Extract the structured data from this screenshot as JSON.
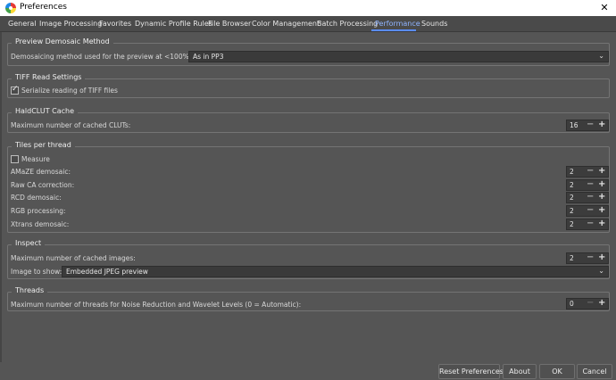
{
  "window": {
    "title": "Preferences"
  },
  "tabs": [
    {
      "label": "General"
    },
    {
      "label": "Image Processing"
    },
    {
      "label": "Favorites"
    },
    {
      "label": "Dynamic Profile Rules"
    },
    {
      "label": "File Browser"
    },
    {
      "label": "Color Management"
    },
    {
      "label": "Batch Processing"
    },
    {
      "label": "Performance"
    },
    {
      "label": "Sounds"
    }
  ],
  "active_tab": "Performance",
  "preview_demosaic": {
    "title": "Preview Demosaic Method",
    "label": "Demosaicing method used for the preview at <100% zoom:",
    "value": "As in PP3"
  },
  "tiff": {
    "title": "TIFF Read Settings",
    "checkbox_label": "Serialize reading of TIFF files",
    "checked": true
  },
  "haldclut": {
    "title": "HaldCLUT Cache",
    "label": "Maximum number of cached CLUTs:",
    "value": "16"
  },
  "tiles": {
    "title": "Tiles per thread",
    "measure_label": "Measure",
    "measure_checked": false,
    "rows": [
      {
        "label": "AMaZE demosaic:",
        "value": "2"
      },
      {
        "label": "Raw CA correction:",
        "value": "2"
      },
      {
        "label": "RCD demosaic:",
        "value": "2"
      },
      {
        "label": "RGB processing:",
        "value": "2"
      },
      {
        "label": "Xtrans demosaic:",
        "value": "2"
      }
    ]
  },
  "inspect": {
    "title": "Inspect",
    "cached_label": "Maximum number of cached images:",
    "cached_value": "2",
    "show_label": "Image to show:",
    "show_value": "Embedded JPEG preview"
  },
  "threads": {
    "title": "Threads",
    "label": "Maximum number of threads for Noise Reduction and Wavelet Levels (0 = Automatic):",
    "value": "0"
  },
  "spin": {
    "minus": "−",
    "plus": "+"
  },
  "footer": {
    "reset": "Reset Preferences",
    "about": "About",
    "ok": "OK",
    "cancel": "Cancel"
  }
}
